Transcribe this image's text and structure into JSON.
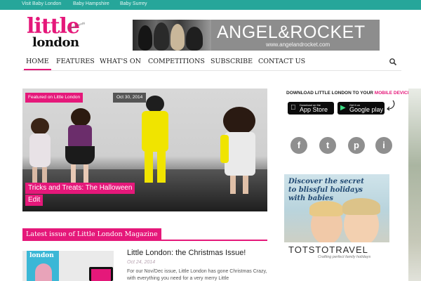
{
  "topbar": {
    "links": [
      "Visit Baby London",
      "Baby Hampshire",
      "Baby Surrey"
    ]
  },
  "logo": {
    "line1": "little",
    "line2": "london",
    "tagline": "Family friendly"
  },
  "banner": {
    "brand": "ANGEL&ROCKET",
    "url": "www.angelandrocket.com"
  },
  "nav": {
    "items": [
      "HOME",
      "FEATURES",
      "WHAT'S ON",
      "COMPETITIONS",
      "SUBSCRIBE",
      "CONTACT US"
    ],
    "active": "HOME",
    "search_icon": "search-icon"
  },
  "hero": {
    "badge": "Featured on Little London",
    "date": "Oct 30, 2014",
    "title": "Tricks and Treats: The Halloween",
    "edit": "Edit"
  },
  "magazine_section": {
    "heading": "Latest issue of Little London Magazine"
  },
  "post": {
    "title": "Little London: the Christmas Issue!",
    "date": "Oct 24, 2014",
    "excerpt": "For our Nov/Dec issue, Little London has gone Christmas Crazy, with everything you need for a very merry Little"
  },
  "sidebar": {
    "download_prefix": "Download Little London to your",
    "download_highlight": "Mobile Device",
    "app_store": {
      "small": "Download on the",
      "big": "App Store"
    },
    "google_play": {
      "small": "Get it on",
      "big": "Google play"
    },
    "social": [
      "f",
      "t",
      "p",
      "i"
    ],
    "social_icons": [
      "facebook-icon",
      "twitter-icon",
      "pinterest-icon",
      "instagram-icon"
    ]
  },
  "ad": {
    "headline": "Discover the secret to blissful holidays with babies",
    "brand": "TOTSTOTRAVEL",
    "tagline": "Crafting perfect family holidays"
  },
  "colors": {
    "accent": "#e5187a",
    "topbar": "#26a69a",
    "social": "#8f8f8f"
  }
}
